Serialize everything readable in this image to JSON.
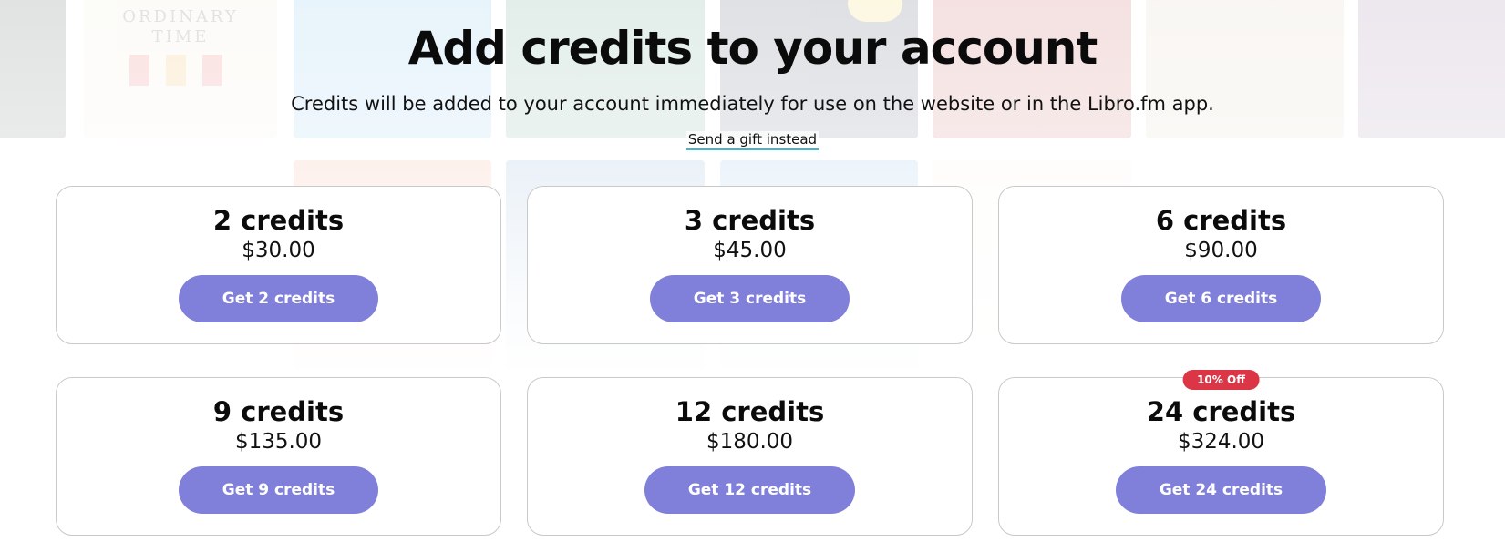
{
  "header": {
    "title": "Add credits to your account",
    "subtitle": "Credits will be added to your account immediately for use on the website or in the Libro.fm app.",
    "gift_link": "Send a gift instead"
  },
  "packages": [
    {
      "credits": "2 credits",
      "price": "$30.00",
      "button": "Get 2 credits",
      "badge": ""
    },
    {
      "credits": "3 credits",
      "price": "$45.00",
      "button": "Get 3 credits",
      "badge": ""
    },
    {
      "credits": "6 credits",
      "price": "$90.00",
      "button": "Get 6 credits",
      "badge": ""
    },
    {
      "credits": "9 credits",
      "price": "$135.00",
      "button": "Get 9 credits",
      "badge": ""
    },
    {
      "credits": "12 credits",
      "price": "$180.00",
      "button": "Get 12 credits",
      "badge": ""
    },
    {
      "credits": "24 credits",
      "price": "$324.00",
      "button": "Get 24 credits",
      "badge": "10% Off"
    }
  ],
  "colors": {
    "button": "#8080db",
    "badge": "#dc3545",
    "link_underline": "#3fb8c9"
  }
}
